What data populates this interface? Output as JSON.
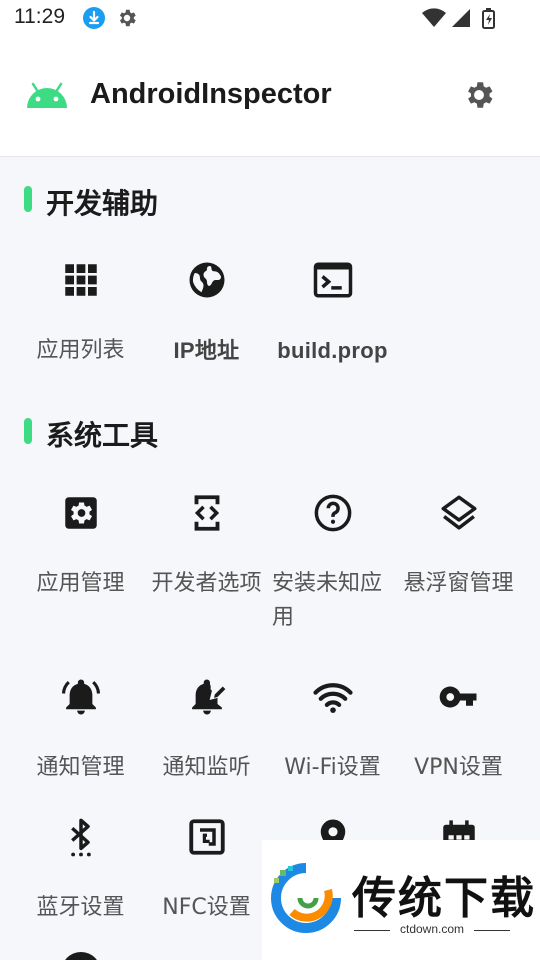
{
  "status_bar": {
    "time": "11:29",
    "icons": [
      "download-icon",
      "gear-icon",
      "wifi-icon",
      "signal-icon",
      "battery-charging-icon"
    ]
  },
  "app_bar": {
    "title": "AndroidInspector",
    "logo_icon": "android-icon",
    "settings_icon": "gear-icon"
  },
  "sections": [
    {
      "title": "开发辅助",
      "items": [
        {
          "label": "应用列表",
          "icon": "grid-apps-icon"
        },
        {
          "label": "IP地址",
          "icon": "globe-icon"
        },
        {
          "label": "build.prop",
          "icon": "terminal-icon"
        }
      ]
    },
    {
      "title": "系统工具",
      "items": [
        {
          "label": "应用管理",
          "icon": "app-settings-icon"
        },
        {
          "label": "开发者选项",
          "icon": "developer-mode-icon"
        },
        {
          "label": "安装未知应用",
          "icon": "help-circle-icon"
        },
        {
          "label": "悬浮窗管理",
          "icon": "layers-icon"
        },
        {
          "label": "通知管理",
          "icon": "bell-icon"
        },
        {
          "label": "通知监听",
          "icon": "bell-edit-icon"
        },
        {
          "label": "Wi-Fi设置",
          "icon": "wifi-icon"
        },
        {
          "label": "VPN设置",
          "icon": "vpn-key-icon"
        },
        {
          "label": "蓝牙设置",
          "icon": "bluetooth-icon"
        },
        {
          "label": "NFC设置",
          "icon": "nfc-icon"
        },
        {
          "label": "",
          "icon": "location-icon"
        },
        {
          "label": "",
          "icon": "calendar-icon"
        }
      ]
    }
  ],
  "watermark": {
    "text": "传统下载",
    "url": "ctdown.com"
  },
  "colors": {
    "accent": "#3ddc84",
    "icon": "#1b1b1b",
    "background": "#f5f7fa",
    "label": "#555555"
  }
}
